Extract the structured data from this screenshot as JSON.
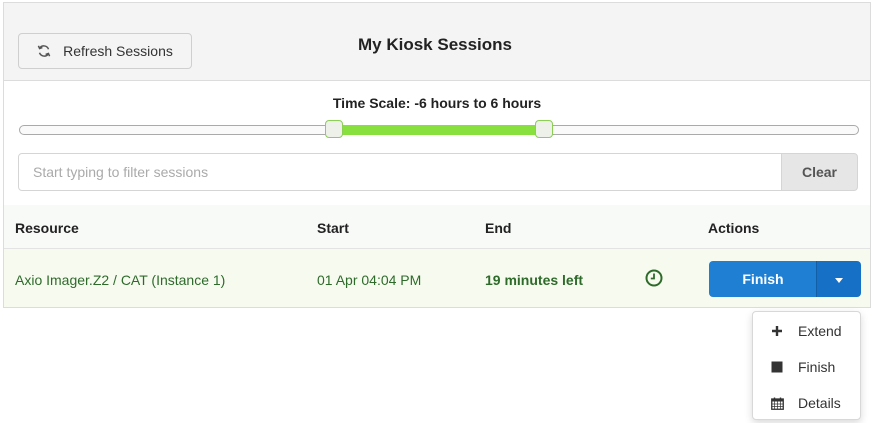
{
  "header": {
    "title": "My Kiosk Sessions",
    "refresh_label": "Refresh Sessions"
  },
  "timescale": {
    "label": "Time Scale: -6 hours to 6 hours",
    "range_start_fraction": 0.375,
    "range_end_fraction": 0.625,
    "range_color": "#88e03f"
  },
  "filter": {
    "placeholder": "Start typing to filter sessions",
    "value": "",
    "clear_label": "Clear"
  },
  "table": {
    "columns": [
      "Resource",
      "Start",
      "End",
      "Actions"
    ],
    "rows": [
      {
        "resource": "Axio Imager.Z2 / CAT (Instance 1)",
        "start": "01 Apr 04:04 PM",
        "end": "19 minutes left",
        "status_icon": "clock-icon",
        "action_label": "Finish"
      }
    ]
  },
  "dropdown": {
    "items": [
      {
        "label": "Extend",
        "icon": "plus-icon"
      },
      {
        "label": "Finish",
        "icon": "stop-icon"
      },
      {
        "label": "Details",
        "icon": "calendar-icon"
      }
    ]
  },
  "colors": {
    "primary": "#1f7fd3",
    "success_text": "#2e6b2b",
    "row_highlight": "#f7fbef"
  }
}
